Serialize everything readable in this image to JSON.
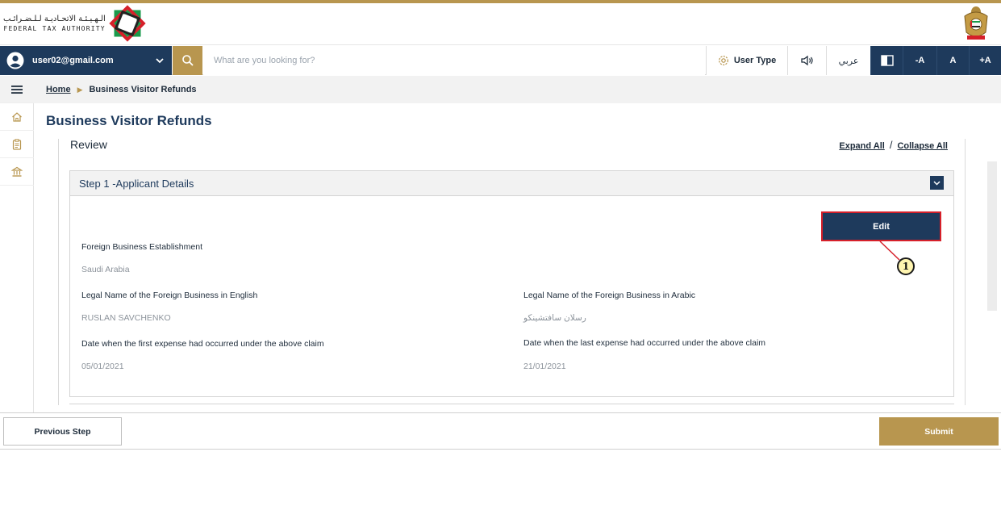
{
  "header": {
    "logo_ar": "الـهـيـئـة الاتحـاديـة لـلـضـرائـب",
    "logo_en": "FEDERAL TAX AUTHORITY"
  },
  "toolbar": {
    "user_email": "user02@gmail.com",
    "search_placeholder": "What are you looking for?",
    "user_type_label": "User Type",
    "arabic_label": "عربي",
    "font_decrease": "-A",
    "font_normal": "A",
    "font_increase": "+A"
  },
  "breadcrumb": {
    "home": "Home",
    "current": "Business Visitor Refunds"
  },
  "page": {
    "title": "Business Visitor Refunds",
    "section": "Review",
    "expand_all": "Expand All",
    "divider": "/",
    "collapse_all": "Collapse All"
  },
  "panel": {
    "title": "Step 1 -Applicant Details",
    "edit_label": "Edit",
    "callout_number": "1",
    "fields": {
      "foreign_est_label": "Foreign Business Establishment",
      "foreign_est_value": "Saudi Arabia",
      "legal_name_en_label": "Legal Name of the Foreign Business in English",
      "legal_name_en_value": "RUSLAN SAVCHENKO",
      "legal_name_ar_label": "Legal Name of the Foreign Business in Arabic",
      "legal_name_ar_value": "رسلان سافتشينكو",
      "first_expense_label": "Date when the first expense had occurred under the above claim",
      "first_expense_value": "05/01/2021",
      "last_expense_label": "Date when the last expense had occurred under the above claim",
      "last_expense_value": "21/01/2021"
    }
  },
  "footer": {
    "previous_label": "Previous Step",
    "submit_label": "Submit"
  },
  "colors": {
    "navy": "#1e3a5c",
    "gold": "#b8964f",
    "callout_red": "#d6202a",
    "badge_yellow": "#fff5b0"
  },
  "icons": {
    "sidebar": [
      "home-icon",
      "clipboard-icon",
      "bank-icon"
    ],
    "menu": "hamburger-menu-icon",
    "search": "search-icon",
    "user_type": "gear-icon",
    "audio": "speaker-icon",
    "contrast": "contrast-icon"
  }
}
